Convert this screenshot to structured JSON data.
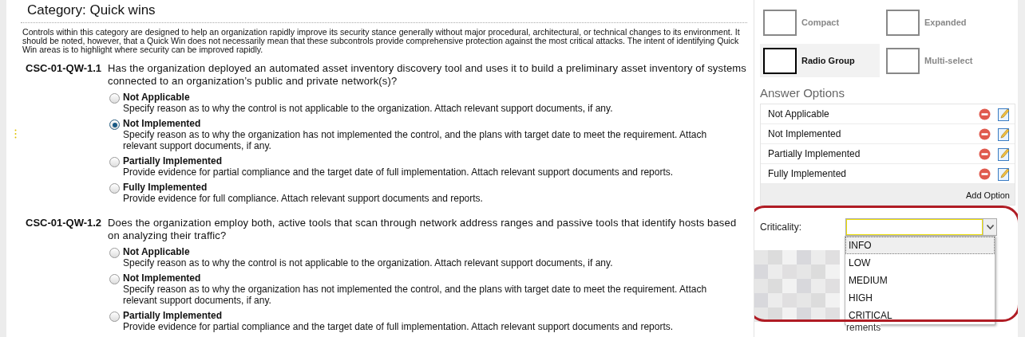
{
  "category_title": "Category: Quick wins",
  "intro": "Controls within this category are designed to help an organization rapidly improve its security stance generally without major procedural, architectural, or technical changes to its environment. It should be noted, however, that a Quick Win does not necessarily mean that these subcontrols provide comprehensive protection against the most critical attacks. The intent of identifying Quick Win areas is to highlight where security can be improved rapidly.",
  "questions": [
    {
      "code": "CSC-01-QW-1.1",
      "text": "Has the organization deployed an automated asset inventory discovery tool and uses it to build a preliminary asset inventory of systems connected to an organization’s public and private network(s)?",
      "options": [
        {
          "label": "Not Applicable",
          "description": "Specify reason as to why the control is not applicable to the organization. Attach relevant support documents, if any.",
          "selected": false
        },
        {
          "label": "Not Implemented",
          "description": "Specify reason as to why the organization has not implemented the control, and the plans with target date to meet the requirement. Attach relevant support documents, if any.",
          "selected": true
        },
        {
          "label": "Partially Implemented",
          "description": "Provide evidence for partial compliance and the target date of full implementation. Attach relevant support documents and reports.",
          "selected": false
        },
        {
          "label": "Fully Implemented",
          "description": "Provide evidence for full compliance. Attach relevant support documents and reports.",
          "selected": false
        }
      ]
    },
    {
      "code": "CSC-01-QW-1.2",
      "text": "Does the organization employ both, active tools that scan through network address ranges and passive tools that identify hosts based on analyzing their traffic?",
      "options": [
        {
          "label": "Not Applicable",
          "description": "Specify reason as to why the control is not applicable to the organization. Attach relevant support documents, if any.",
          "selected": false
        },
        {
          "label": "Not Implemented",
          "description": "Specify reason as to why the organization has not implemented the control, and the plans with target date to meet the requirement. Attach relevant support documents, if any.",
          "selected": false
        },
        {
          "label": "Partially Implemented",
          "description": "Provide evidence for partial compliance and the target date of full implementation. Attach relevant support documents and reports.",
          "selected": false
        }
      ]
    }
  ],
  "display_styles": [
    {
      "label": "Compact",
      "selected": false
    },
    {
      "label": "Expanded",
      "selected": false
    },
    {
      "label": "Radio Group",
      "selected": true
    },
    {
      "label": "Multi-select",
      "selected": false
    }
  ],
  "answer_options_heading": "Answer Options",
  "answer_options": [
    {
      "label": "Not Applicable"
    },
    {
      "label": "Not Implemented"
    },
    {
      "label": "Partially Implemented"
    },
    {
      "label": "Fully Implemented"
    }
  ],
  "add_option": "Add Option",
  "criticality": {
    "label": "Criticality:",
    "items": [
      {
        "label": "INFO",
        "selected": true
      },
      {
        "label": "LOW",
        "selected": false
      },
      {
        "label": "MEDIUM",
        "selected": false
      },
      {
        "label": "HIGH",
        "selected": false
      },
      {
        "label": "CRITICAL",
        "selected": false
      }
    ]
  },
  "partial_text": "rements"
}
